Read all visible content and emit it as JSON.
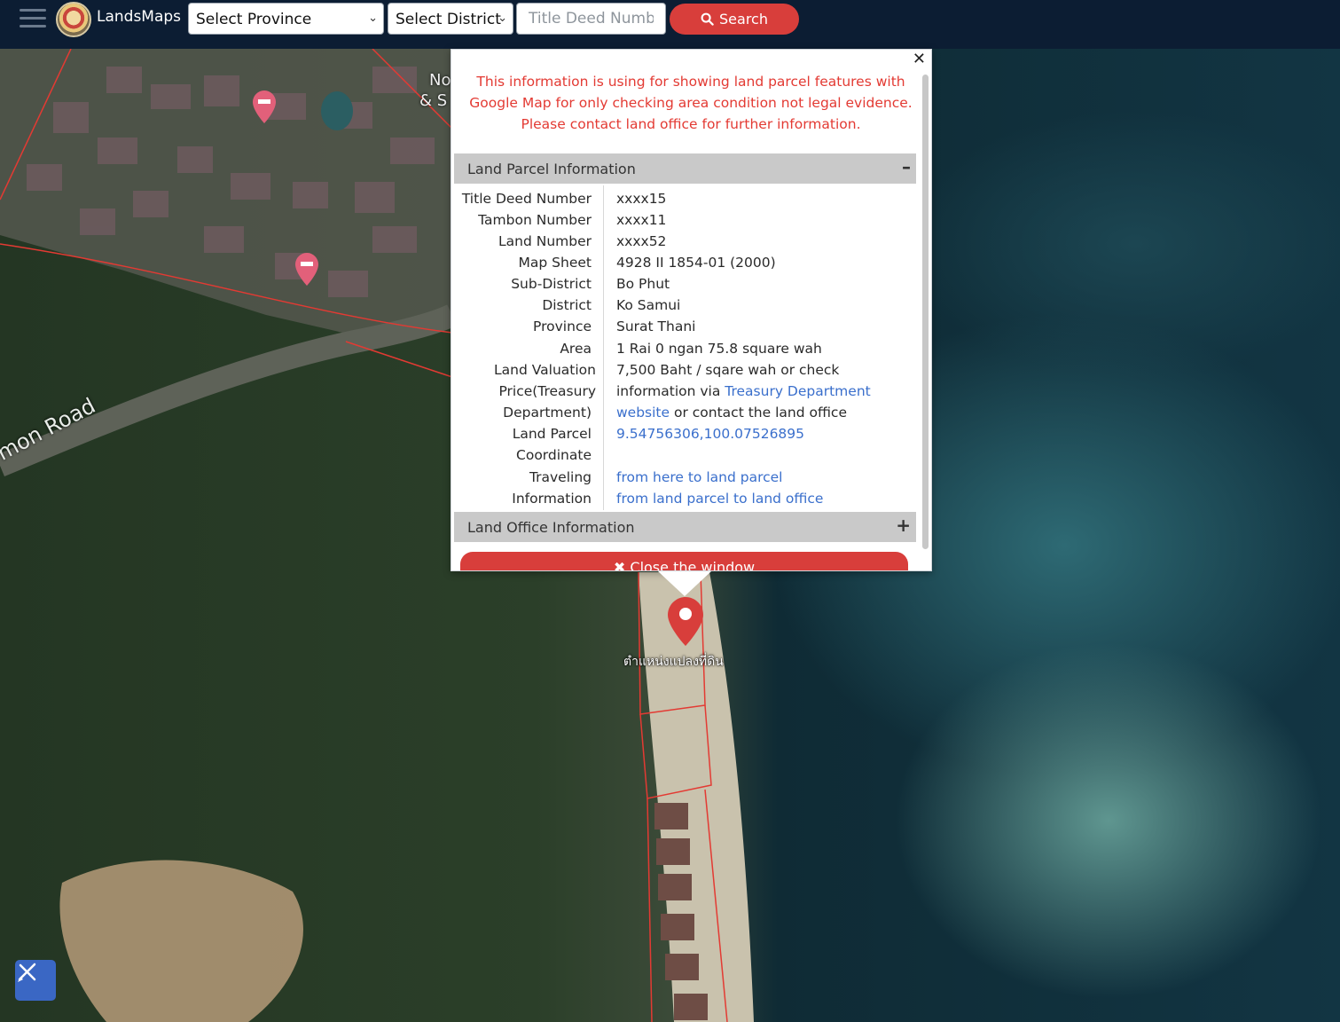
{
  "header": {
    "brand": "LandsMaps",
    "province_select": "Select Province",
    "district_select": "Select District",
    "deed_placeholder": "Title Deed Number",
    "search_label": "Search"
  },
  "map": {
    "road_label": "mon Road",
    "marker_label": "ตำแหน่งแปลงที่ดิน",
    "partial_label_1": "No",
    "partial_label_2": "& S"
  },
  "popup": {
    "disclaimer": "This information is using for showing land parcel features with Google Map for only checking area condition not legal evidence. Please contact land office for further information.",
    "parcel_section_title": "Land Parcel Information",
    "office_section_title": "Land Office Information",
    "close_button": "Close the window",
    "rows": {
      "title_deed": {
        "label": "Title Deed Number",
        "value": "xxxx15"
      },
      "tambon": {
        "label": "Tambon Number",
        "value": "xxxx11"
      },
      "land_number": {
        "label": "Land Number",
        "value": "xxxx52"
      },
      "map_sheet": {
        "label": "Map Sheet",
        "value": "4928 II 1854-01 (2000)"
      },
      "sub_district": {
        "label": "Sub-District",
        "value": "Bo Phut"
      },
      "district": {
        "label": "District",
        "value": "Ko Samui"
      },
      "province": {
        "label": "Province",
        "value": "Surat Thani"
      },
      "area": {
        "label": "Area",
        "value": "1 Rai 0 ngan 75.8 square wah"
      }
    },
    "valuation": {
      "label_line1": "Land Valuation",
      "label_line2": "Price(Treasury",
      "label_line3": "Department)",
      "text_line1": "7,500 Baht / sqare wah or check",
      "text_line2_prefix": "information via ",
      "treasury_link": "Treasury Department",
      "website_link": "website",
      "text_line3_suffix": " or contact the land office"
    },
    "coordinate": {
      "label_line1": "Land Parcel",
      "label_line2": "Coordinate",
      "value": "9.54756306,100.07526895"
    },
    "traveling": {
      "label_line1": "Traveling",
      "label_line2": "Information",
      "link1": "from here to land parcel",
      "link2": "from land parcel to land office"
    }
  },
  "colors": {
    "topbar": "#0c1d33",
    "accent_red": "#d83e3b",
    "disclaimer_red": "#e33a33",
    "link_blue": "#3a6fcc",
    "section_gray": "#c9c9c9"
  },
  "icons": [
    "menu-icon",
    "search-icon",
    "close-icon",
    "minus-icon",
    "plus-icon",
    "map-pin-icon",
    "hotel-pin-icon",
    "measure-tool-icon"
  ]
}
